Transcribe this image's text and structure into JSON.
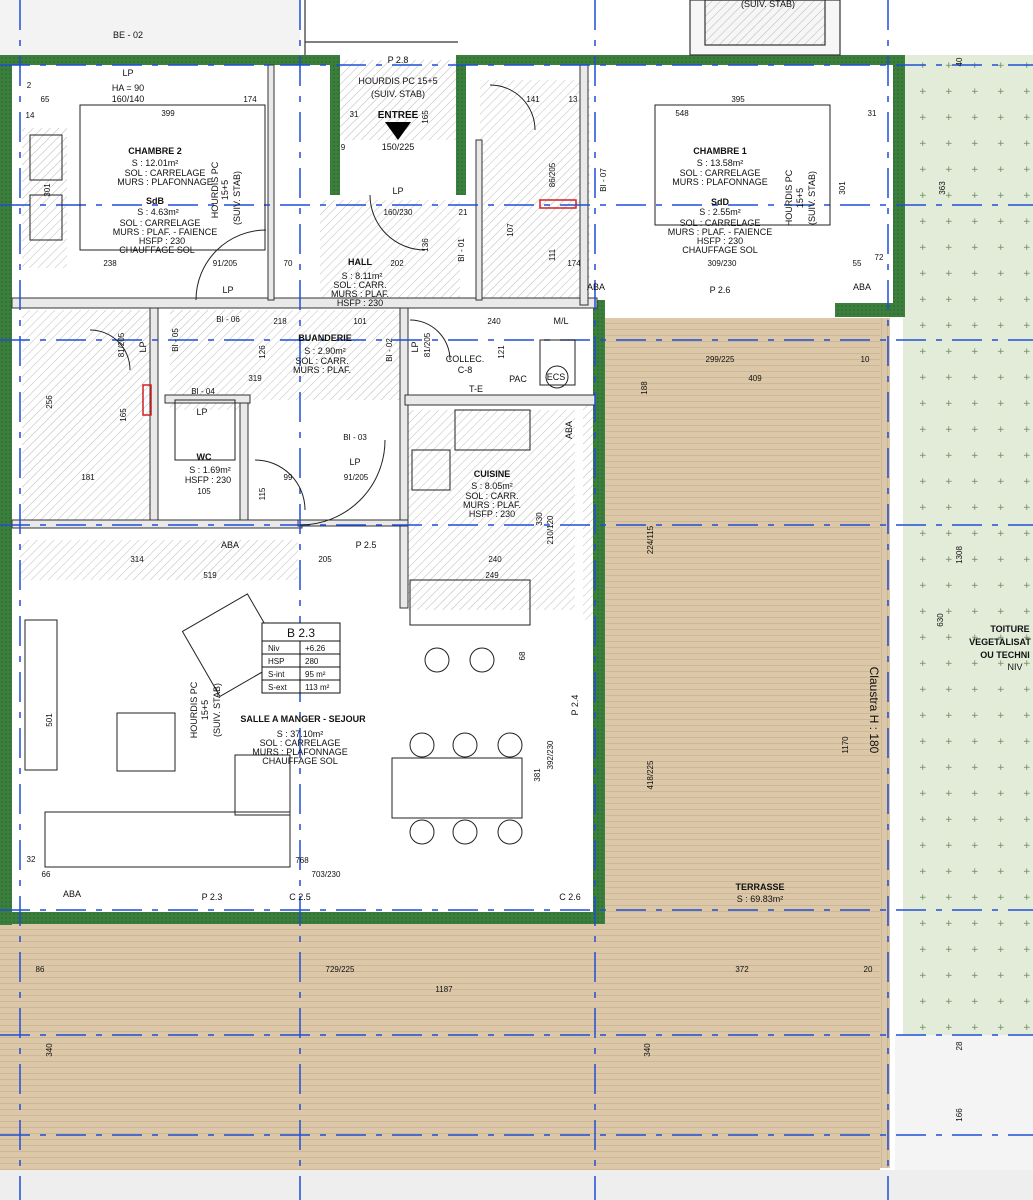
{
  "colors": {
    "wall_green": "#3b7f3c",
    "grid_blue": "#1f4fd6",
    "terrace_fill": "#dcc8a8",
    "roof_fill": "#e3ecd9",
    "hatch": "#9a9a9a"
  },
  "top_labels": {
    "be02": "BE - 02",
    "suiv_stab_top": "(SUIV. STAB)",
    "p28": "P 2.8",
    "hourdis_top": "HOURDIS PC 15+5",
    "suiv_stab_entry": "(SUIV. STAB)",
    "entree": "ENTREE",
    "entree_dim": "150/225",
    "lp_top": "LP",
    "ha": "HA = 90",
    "ha_dim": "160/140"
  },
  "rooms": {
    "chambre2": {
      "name": "CHAMBRE 2",
      "area": "S : 12.01m²",
      "sol": "SOL : CARRELAGE",
      "murs": "MURS : PLAFONNAGE"
    },
    "sdb2": {
      "name": "SdB",
      "area": "S : 4.63m²",
      "sol": "SOL : CARRELAGE",
      "murs": "MURS : PLAF. - FAIENCE",
      "hsfp": "HSFP : 230",
      "chauff": "CHAUFFAGE SOL"
    },
    "chambre1": {
      "name": "CHAMBRE 1",
      "area": "S : 13.58m²",
      "sol": "SOL : CARRELAGE",
      "murs": "MURS : PLAFONNAGE"
    },
    "sdb1": {
      "name": "SdD",
      "area": "S : 2.55m²",
      "sol": "SOL : CARRELAGE",
      "murs": "MURS : PLAF. - FAIENCE",
      "hsfp": "HSFP : 230",
      "chauff": "CHAUFFAGE SOL"
    },
    "hall": {
      "name": "HALL",
      "area": "S : 8.11m²",
      "sol": "SOL : CARR.",
      "murs": "MURS : PLAF.",
      "hsfp": "HSFP : 230"
    },
    "buanderie": {
      "name": "BUANDERIE",
      "area": "S : 2.90m²",
      "sol": "SOL : CARR.",
      "murs": "MURS : PLAF."
    },
    "wc": {
      "name": "WC",
      "area": "S : 1.69m²",
      "hsfp": "HSFP : 230"
    },
    "cuisine": {
      "name": "CUISINE",
      "area": "S : 8.05m²",
      "sol": "SOL : CARR.",
      "murs": "MURS : PLAF.",
      "hsfp": "HSFP : 230"
    },
    "sejour": {
      "name": "SALLE A MANGER - SEJOUR",
      "area": "S : 37.10m²",
      "sol": "SOL : CARRELAGE",
      "murs": "MURS : PLAFONNAGE",
      "chauff": "CHAUFFAGE SOL"
    },
    "terrasse": {
      "name": "TERRASSE",
      "area": "S : 69.83m²"
    },
    "collec": {
      "name": "COLLEC.",
      "sub": "C-8"
    },
    "toiture": {
      "l1": "TOITURE",
      "l2": "VEGETALISAT",
      "l3": "OU TECHNI",
      "l4": "NIV"
    }
  },
  "unit_table": {
    "title": "B 2.3",
    "rows": [
      {
        "k": "Niv",
        "v": "+6.26"
      },
      {
        "k": "HSP",
        "v": "280"
      },
      {
        "k": "S-int",
        "v": "95 m²"
      },
      {
        "k": "S-ext",
        "v": "113 m²"
      }
    ]
  },
  "misc_labels": {
    "hourdis_pc": "HOURDIS PC",
    "hourdis_15": "15+5",
    "suiv_stab": "(SUIV. STAB)",
    "claustra": "Claustra H : 180",
    "aba": "ABA",
    "lp": "LP",
    "pac": "PAC",
    "ecs": "ECS",
    "te": "T-E",
    "msl": "M/L",
    "p26": "P 2.6",
    "p25": "P 2.5",
    "p24": "P 2.4",
    "p23": "P 2.3",
    "c25": "C 2.5",
    "c26": "C 2.6",
    "bi01": "BI - 01",
    "bi02": "BI - 02",
    "bi03": "BI - 03",
    "bi04": "BI - 04",
    "bi05": "BI - 05",
    "bi06": "BI - 06",
    "bi07": "BI - 07"
  },
  "dimensions": {
    "d399": "399",
    "d174": "174",
    "d65": "65",
    "d14": "14",
    "d2": "2",
    "d141": "141",
    "d13": "13",
    "d31a": "31",
    "d165": "165",
    "d9": "9",
    "d548": "548",
    "d395": "395",
    "d31b": "31",
    "d301a": "301",
    "d238": "238",
    "d91205a": "91/205",
    "d70": "70",
    "d202": "202",
    "d16023": "160/230",
    "d21": "21",
    "d136": "136",
    "d107": "107",
    "d111": "111",
    "d86205": "86/205",
    "d174b": "174",
    "d309230": "309/230",
    "d55": "55",
    "d72": "72",
    "d301b": "301",
    "d363": "363",
    "d40": "40",
    "d218": "218",
    "d101": "101",
    "d240a": "240",
    "d81205a": "81/205",
    "d126": "126",
    "d319": "319",
    "d81205b": "81/205",
    "d121": "121",
    "d299225": "299/225",
    "d409": "409",
    "d10": "10",
    "d188": "188",
    "d256": "256",
    "d165b": "165",
    "d181": "181",
    "d99": "99",
    "d91205b": "91/205",
    "d105": "105",
    "d115": "115",
    "d314": "314",
    "d519": "519",
    "d205": "205",
    "d240b": "240",
    "d249": "249",
    "d330": "330",
    "d210120": "210/120",
    "d224115": "224/115",
    "d1308": "1308",
    "d630": "630",
    "d501": "501",
    "d68": "68",
    "d381": "381",
    "d392230": "392/230",
    "d418225": "418/225",
    "d1170": "1170",
    "d32": "32",
    "d703230": "703/230",
    "d768": "768",
    "d66": "66",
    "d86": "86",
    "d729225": "729/225",
    "d372": "372",
    "d20": "20",
    "d1187": "1187",
    "d340a": "340",
    "d340b": "340",
    "d166": "166",
    "d28": "28"
  }
}
